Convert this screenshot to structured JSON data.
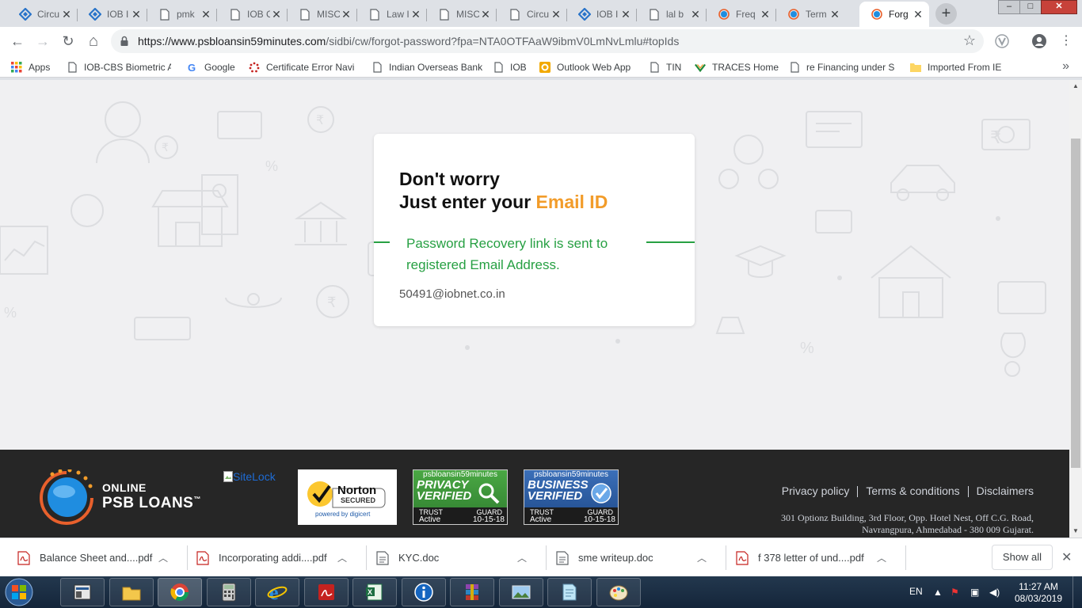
{
  "browser": {
    "tabs": [
      {
        "title": "Circu",
        "icon": "iob-logo-icon",
        "active": false
      },
      {
        "title": "IOB I",
        "icon": "iob-logo-icon",
        "active": false
      },
      {
        "title": "pmk",
        "icon": "page-icon",
        "active": false
      },
      {
        "title": "IOB C",
        "icon": "page-icon",
        "active": false
      },
      {
        "title": "MISC",
        "icon": "page-icon",
        "active": false
      },
      {
        "title": "Law I",
        "icon": "page-icon",
        "active": false
      },
      {
        "title": "MISC",
        "icon": "page-icon",
        "active": false
      },
      {
        "title": "Circu",
        "icon": "page-icon",
        "active": false
      },
      {
        "title": "IOB I",
        "icon": "iob-logo-icon",
        "active": false
      },
      {
        "title": "lal b",
        "icon": "page-icon",
        "active": false
      },
      {
        "title": "Freq",
        "icon": "psb-icon",
        "active": false
      },
      {
        "title": "Term",
        "icon": "psb-icon",
        "active": false
      },
      {
        "title": "Forg",
        "icon": "psb-icon",
        "active": true
      }
    ],
    "new_tab": "+",
    "window_controls": {
      "minimize": "–",
      "maximize": "□",
      "close": "✕"
    },
    "nav": {
      "back": "←",
      "forward": "→",
      "reload": "↻",
      "home": "⌂"
    },
    "url": {
      "host": "https://www.psbloansin59minutes.com",
      "path": "/sidbi/cw/forgot-password?fpa=NTA0OTFAaW9ibmV0LmNvLmlu#topIds"
    },
    "bookmarks": [
      {
        "label": "Apps",
        "icon": "apps-grid-icon"
      },
      {
        "label": "IOB-CBS Biometric A",
        "icon": "page-icon"
      },
      {
        "label": "Google",
        "icon": "google-icon"
      },
      {
        "label": "Certificate Error Navi",
        "icon": "loading-icon"
      },
      {
        "label": "Indian Overseas Bank",
        "icon": "page-icon"
      },
      {
        "label": "IOB",
        "icon": "page-icon"
      },
      {
        "label": "Outlook Web App",
        "icon": "outlook-icon"
      },
      {
        "label": "TIN",
        "icon": "page-icon"
      },
      {
        "label": "TRACES Home",
        "icon": "traces-icon"
      },
      {
        "label": "re Financing under S",
        "icon": "page-icon"
      },
      {
        "label": "Imported From IE",
        "icon": "folder-icon"
      }
    ],
    "bookmarks_more": "»"
  },
  "page": {
    "heading_line1": "Don't worry",
    "heading_line2_prefix": "Just enter your ",
    "heading_line2_accent": "Email ID",
    "success_message": "Password Recovery link is sent to registered Email Address.",
    "email": "50491@iobnet.co.in",
    "colors": {
      "accent": "#f29c2a",
      "success": "#27a043",
      "footer_bg": "#262626",
      "page_bg": "#f0f0f2"
    }
  },
  "footer": {
    "logo_line1": "ONLINE",
    "logo_line2": "PSB LOANS",
    "logo_tm": "™",
    "sitelock_alt": "SiteLock",
    "norton": {
      "brand": "Norton",
      "secured": "SECURED",
      "powered": "powered by digicert"
    },
    "privacy_badge": {
      "site": "psbloansin59minutes",
      "line1": "PRIVACY",
      "line2": "VERIFIED",
      "trust": "TRUST",
      "guard": "GUARD",
      "status": "Active",
      "date": "10-15-18"
    },
    "business_badge": {
      "site": "psbloansin59minutes",
      "line1": "BUSINESS",
      "line2": "VERIFIED",
      "trust": "TRUST",
      "guard": "GUARD",
      "status": "Active",
      "date": "10-15-18"
    },
    "links": [
      "Privacy policy",
      "Terms & conditions",
      "Disclaimers"
    ],
    "address_line1": "301 Optionz Building, 3rd Floor, Opp. Hotel Nest, Off C.G. Road,",
    "address_line2": "Navrangpura, Ahmedabad - 380 009 Gujarat."
  },
  "downloads": {
    "items": [
      {
        "name": "Balance Sheet and....pdf",
        "icon": "pdf-file-icon"
      },
      {
        "name": "Incorporating addi....pdf",
        "icon": "pdf-file-icon"
      },
      {
        "name": "KYC.doc",
        "icon": "doc-file-icon"
      },
      {
        "name": "sme writeup.doc",
        "icon": "doc-file-icon"
      },
      {
        "name": "f 378 letter of und....pdf",
        "icon": "pdf-file-icon"
      }
    ],
    "show_all": "Show all",
    "close": "✕"
  },
  "taskbar": {
    "apps": [
      "windows-explorer-icon",
      "file-folder-icon",
      "chrome-icon",
      "calculator-icon",
      "internet-explorer-icon",
      "adobe-reader-icon",
      "excel-icon",
      "info-icon",
      "winrar-icon",
      "image-viewer-icon",
      "notepad-icon",
      "paint-icon"
    ],
    "language": "EN",
    "time": "11:27 AM",
    "date": "08/03/2019"
  }
}
